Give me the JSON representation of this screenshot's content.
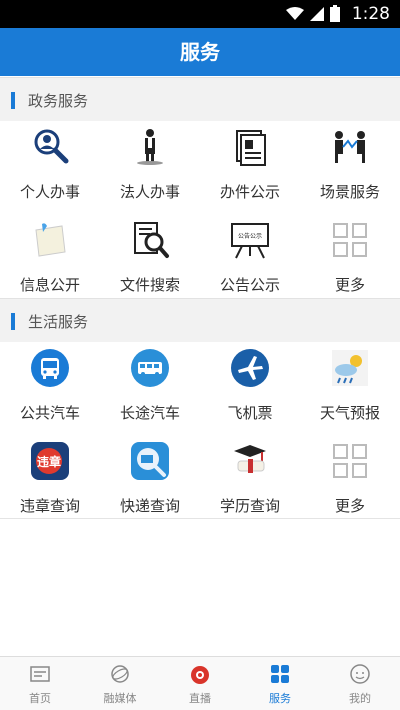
{
  "status_bar": {
    "time": "1:28"
  },
  "header": {
    "title": "服务"
  },
  "sections": [
    {
      "title": "政务服务",
      "items": [
        {
          "label": "个人办事",
          "icon": "personal-affairs-icon"
        },
        {
          "label": "法人办事",
          "icon": "legal-person-icon"
        },
        {
          "label": "办件公示",
          "icon": "case-notice-icon"
        },
        {
          "label": "场景服务",
          "icon": "scene-service-icon"
        },
        {
          "label": "信息公开",
          "icon": "info-disclosure-icon"
        },
        {
          "label": "文件搜索",
          "icon": "file-search-icon"
        },
        {
          "label": "公告公示",
          "icon": "announcement-board-icon"
        },
        {
          "label": "更多",
          "icon": "more-grid-icon"
        }
      ]
    },
    {
      "title": "生活服务",
      "items": [
        {
          "label": "公共汽车",
          "icon": "bus-icon"
        },
        {
          "label": "长途汽车",
          "icon": "coach-icon"
        },
        {
          "label": "飞机票",
          "icon": "airplane-icon"
        },
        {
          "label": "天气预报",
          "icon": "weather-icon"
        },
        {
          "label": "违章查询",
          "icon": "violation-icon"
        },
        {
          "label": "快递查询",
          "icon": "express-icon"
        },
        {
          "label": "学历查询",
          "icon": "graduation-cap-icon"
        },
        {
          "label": "更多",
          "icon": "more-grid-icon"
        }
      ]
    }
  ],
  "misc": {
    "announcement_board_text": "公告公示",
    "violation_text": "违章"
  },
  "tabs": [
    {
      "label": "首页",
      "icon": "home-icon",
      "active": false
    },
    {
      "label": "融媒体",
      "icon": "media-icon",
      "active": false
    },
    {
      "label": "直播",
      "icon": "live-icon",
      "active": false
    },
    {
      "label": "服务",
      "icon": "services-icon",
      "active": true
    },
    {
      "label": "我的",
      "icon": "profile-icon",
      "active": false
    }
  ],
  "colors": {
    "accent": "#1a7bd6",
    "section_bg": "#f2f2f2"
  }
}
